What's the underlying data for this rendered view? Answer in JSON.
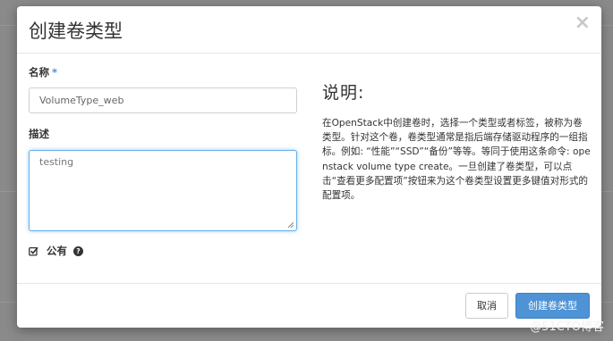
{
  "dialog": {
    "title": "创建卷类型",
    "close_glyph": "×"
  },
  "form": {
    "name_label": "名称",
    "required_mark": "*",
    "name_value": "VolumeType_web",
    "description_label": "描述",
    "description_value": "testing",
    "public_label": "公有",
    "public_checked": true,
    "help_glyph": "?"
  },
  "explanation": {
    "title": "说明:",
    "body": "在OpenStack中创建卷时，选择一个类型或者标签，被称为卷类型。针对这个卷，卷类型通常是指后端存储驱动程序的一组指标。例如: “性能”“SSD”“备份”等等。等同于使用这条命令: openstack volume type create。一旦创建了卷类型，可以点击“查看更多配置项”按钮来为这个卷类型设置更多键值对形式的配置项。"
  },
  "footer": {
    "cancel_label": "取消",
    "submit_label": "创建卷类型"
  },
  "watermark": "@51CTO博客",
  "icons": {
    "close": "close-icon",
    "checkbox": "checkbox-checked-icon",
    "help": "question-circle-icon"
  },
  "colors": {
    "primary_button": "#4d93d6",
    "required_star": "#4b8fd1",
    "focus_border": "#66afe9"
  }
}
